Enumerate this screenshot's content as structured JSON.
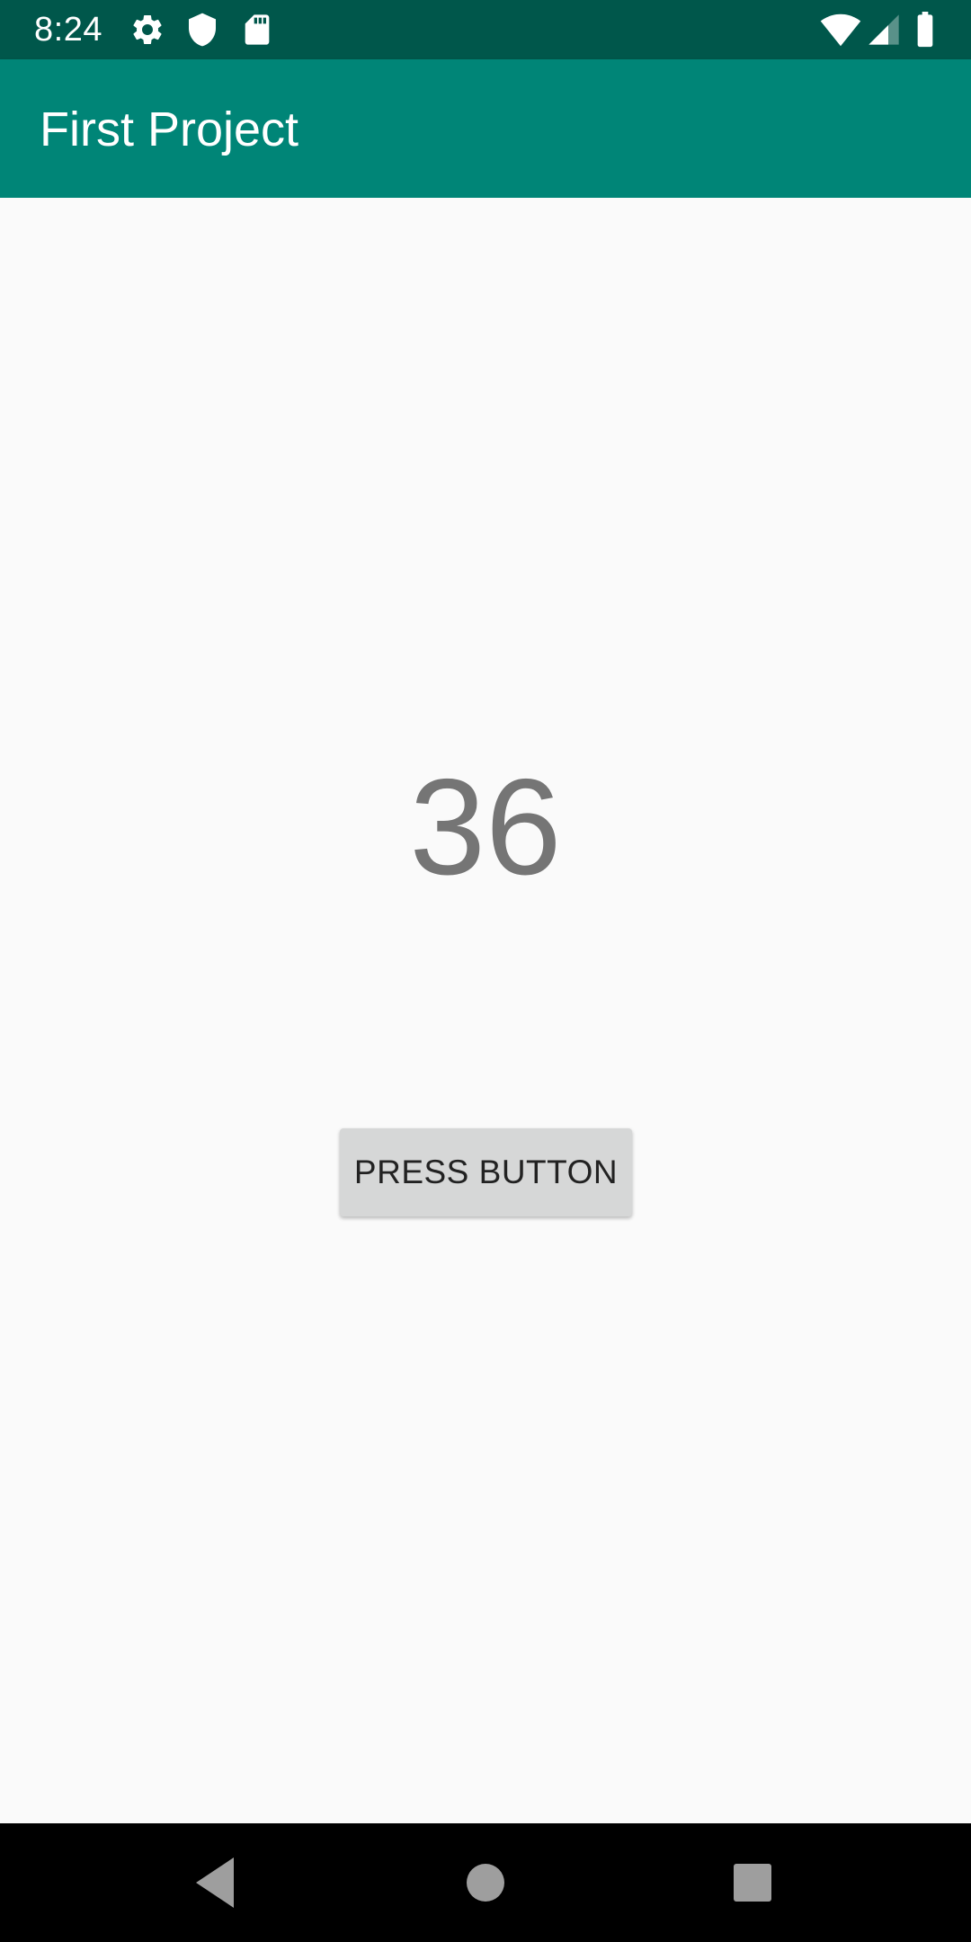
{
  "status_bar": {
    "time": "8:24",
    "left_icons": [
      "gear-icon",
      "shield-icon",
      "sd-card-icon"
    ],
    "right_icons": [
      "wifi-icon",
      "cell-signal-icon",
      "battery-icon"
    ]
  },
  "app_bar": {
    "title": "First Project"
  },
  "main": {
    "counter_value": "36",
    "button_label": "PRESS BUTTON"
  },
  "nav_bar": {
    "buttons": [
      "back-icon",
      "home-icon",
      "recents-icon"
    ]
  },
  "colors": {
    "status_bar": "#00574b",
    "app_bar": "#008577",
    "background": "#fafafa",
    "counter_text": "#757575",
    "button_bg": "#d6d7d7",
    "nav_bar": "#000000"
  }
}
